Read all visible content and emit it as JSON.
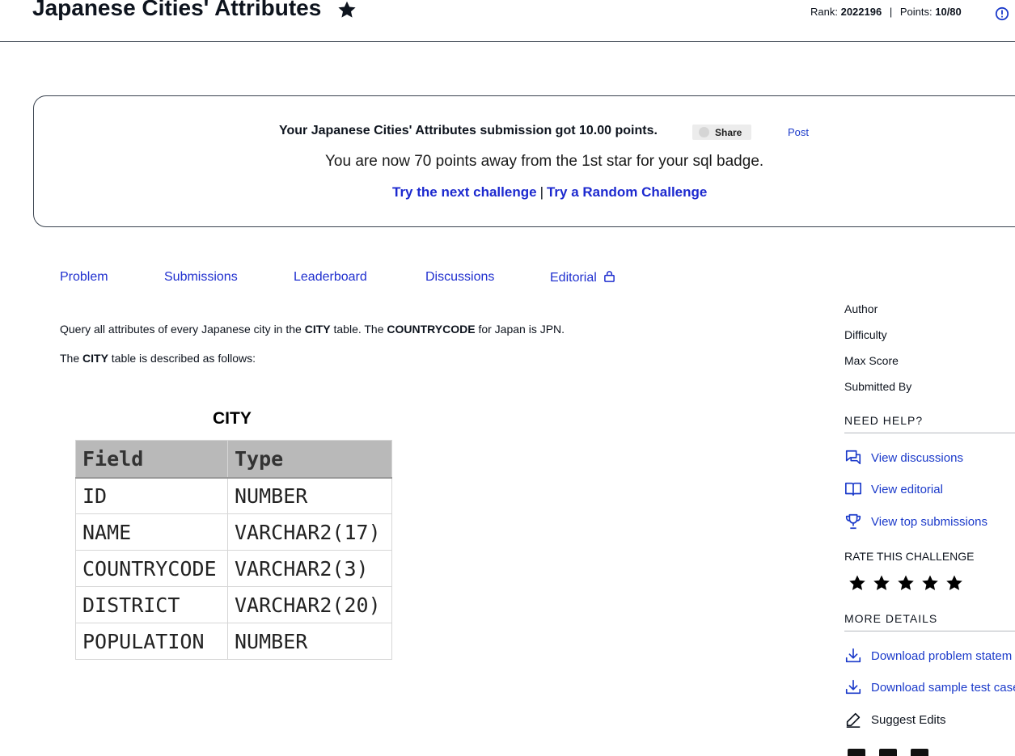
{
  "header": {
    "title": "Japanese Cities' Attributes",
    "rank_label": "Rank:",
    "rank_value": "2022196",
    "points_label": "Points:",
    "points_value": "10/80"
  },
  "banner": {
    "line1": "Your Japanese Cities' Attributes submission got 10.00 points.",
    "share_label": "Share",
    "post_label": "Post",
    "line2": "You are now 70 points away from the 1st star for your sql badge.",
    "next_challenge": "Try the next challenge",
    "separator": "|",
    "random_challenge": "Try a Random Challenge"
  },
  "tabs": [
    {
      "label": "Problem"
    },
    {
      "label": "Submissions"
    },
    {
      "label": "Leaderboard"
    },
    {
      "label": "Discussions"
    },
    {
      "label": "Editorial"
    }
  ],
  "problem": {
    "p1_pre": "Query all attributes of every Japanese city in the ",
    "p1_b1": "CITY",
    "p1_mid": " table. The ",
    "p1_b2": "COUNTRYCODE",
    "p1_post": " for Japan is JPN.",
    "p2_pre": "The ",
    "p2_b": "CITY",
    "p2_post": " table is described as follows:"
  },
  "city_table": {
    "title": "CITY",
    "headers": [
      "Field",
      "Type"
    ],
    "rows": [
      [
        "ID",
        "NUMBER"
      ],
      [
        "NAME",
        "VARCHAR2(17)"
      ],
      [
        "COUNTRYCODE",
        "VARCHAR2(3)"
      ],
      [
        "DISTRICT",
        "VARCHAR2(20)"
      ],
      [
        "POPULATION",
        "NUMBER"
      ]
    ]
  },
  "sidebar": {
    "meta": [
      "Author",
      "Difficulty",
      "Max Score",
      "Submitted By"
    ],
    "need_help": "NEED HELP?",
    "help_links": [
      "View discussions",
      "View editorial",
      "View top submissions"
    ],
    "rate_heading": "RATE THIS CHALLENGE",
    "rating_stars": 5,
    "more_details": "MORE DETAILS",
    "detail_links": [
      "Download problem statem",
      "Download sample test case"
    ],
    "suggest_edits": "Suggest Edits"
  },
  "colors": {
    "link": "#1b3aca",
    "text": "#0e141e"
  }
}
